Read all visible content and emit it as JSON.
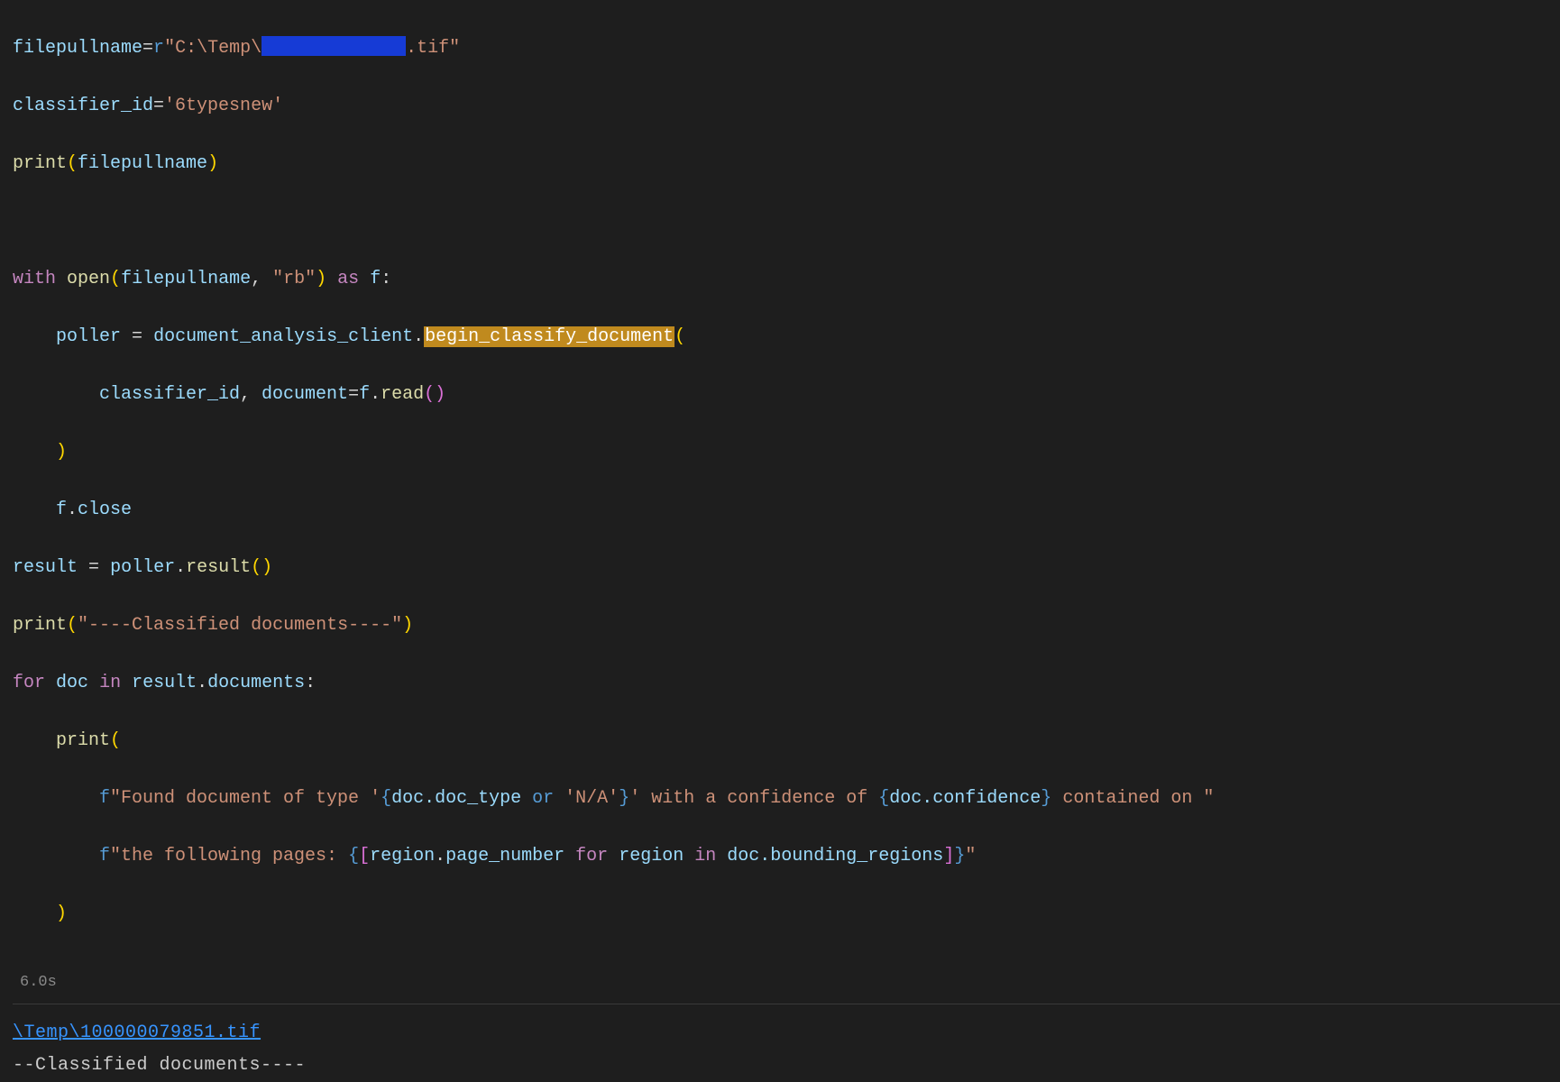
{
  "code": {
    "filepullname_var": "filepullname",
    "eq": "=",
    "r_prefix": "r",
    "path_open": "\"C:\\Temp\\",
    "path_close": ".tif\"",
    "classifier_var": "classifier_id",
    "classifier_val": "'6typesnew'",
    "print_fn": "print",
    "with_kw": "with",
    "open_fn": "open",
    "rb": "\"rb\"",
    "as_kw": "as",
    "f_var": "f",
    "colon": ":",
    "poller_var": "poller",
    "dac": "document_analysis_client",
    "begin_method": "begin_classify_document",
    "document_kw": "document",
    "read_fn": "read",
    "close_attr": "close",
    "result_var": "result",
    "result_fn": "result",
    "classified_str": "\"----Classified documents----\"",
    "for_kw": "for",
    "doc_var": "doc",
    "in_kw": "in",
    "documents_attr": "documents",
    "fprefix": "f",
    "fstr1a": "\"Found document of type '",
    "fstr1b": "' with a confidence of ",
    "fstr1c": " contained on \"",
    "doc_type": "doc.doc_type",
    "or_kw": "or",
    "na": "'N/A'",
    "confidence": "doc.confidence",
    "fstr2a": "\"the following pages: ",
    "fstr2b": "\"",
    "region_var": "region",
    "page_number": "page_number",
    "bounding": "doc.bounding_regions"
  },
  "exec": {
    "time": "6.0s"
  },
  "output": {
    "link": "\\Temp\\100000079851.tif",
    "line2": "--Classified documents----"
  }
}
